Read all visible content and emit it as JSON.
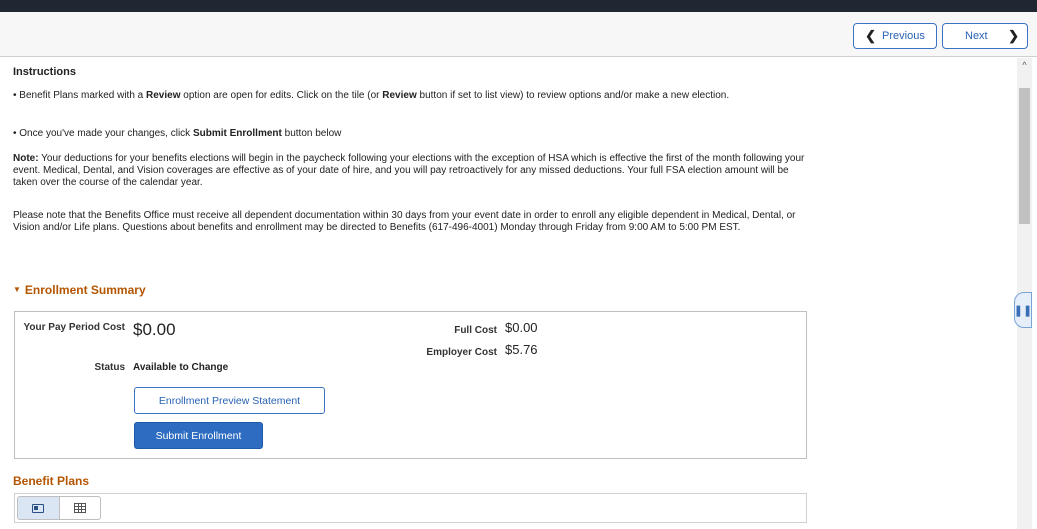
{
  "nav": {
    "previous_label": "Previous",
    "next_label": "Next"
  },
  "instructions": {
    "heading": "Instructions",
    "bullet1_pre": "• Benefit Plans marked with a ",
    "bullet1_bold1": "Review",
    "bullet1_mid": " option are open for edits. Click on the tile (or ",
    "bullet1_bold2": "Review",
    "bullet1_post": " button if set to list view) to review options and/or make a new election.",
    "bullet2_pre": "• Once you've made your changes, click ",
    "bullet2_bold": "Submit Enrollment",
    "bullet2_post": " button below",
    "note_label": "Note:",
    "note_text": " Your deductions for your benefits elections will begin in the paycheck following your elections with the exception of HSA which is effective the first of the month following your event. Medical, Dental, and Vision coverages are effective as of your date of hire, and you will pay retroactively for any missed deductions. Your full FSA election amount will be taken over the course of the calendar year.",
    "please_note": "Please note that the Benefits Office must receive all dependent documentation within 30 days from your event date in order to enroll any eligible dependent in Medical, Dental, or Vision and/or Life plans. Questions about benefits and enrollment may be directed to Benefits (617-496-4001) Monday through Friday from 9:00 AM to 5:00 PM EST."
  },
  "summary": {
    "title": "Enrollment Summary",
    "pay_period_cost_label": "Your Pay Period Cost",
    "pay_period_cost_value": "$0.00",
    "status_label": "Status",
    "status_value": "Available to Change",
    "full_cost_label": "Full Cost",
    "full_cost_value": "$0.00",
    "employer_cost_label": "Employer Cost",
    "employer_cost_value": "$5.76",
    "preview_button": "Enrollment Preview Statement",
    "submit_button": "Submit Enrollment"
  },
  "benefit_plans": {
    "title": "Benefit Plans"
  },
  "icons": {
    "previous": "chevron-left-icon",
    "next": "chevron-right-icon",
    "collapse": "caret-down-icon",
    "side_tab": "pause-icon",
    "tile_view": "tile-view-icon",
    "list_view": "grid-view-icon"
  },
  "colors": {
    "accent": "#2d6cc0",
    "section_title": "#b45500",
    "top_bar": "#1f2733"
  }
}
